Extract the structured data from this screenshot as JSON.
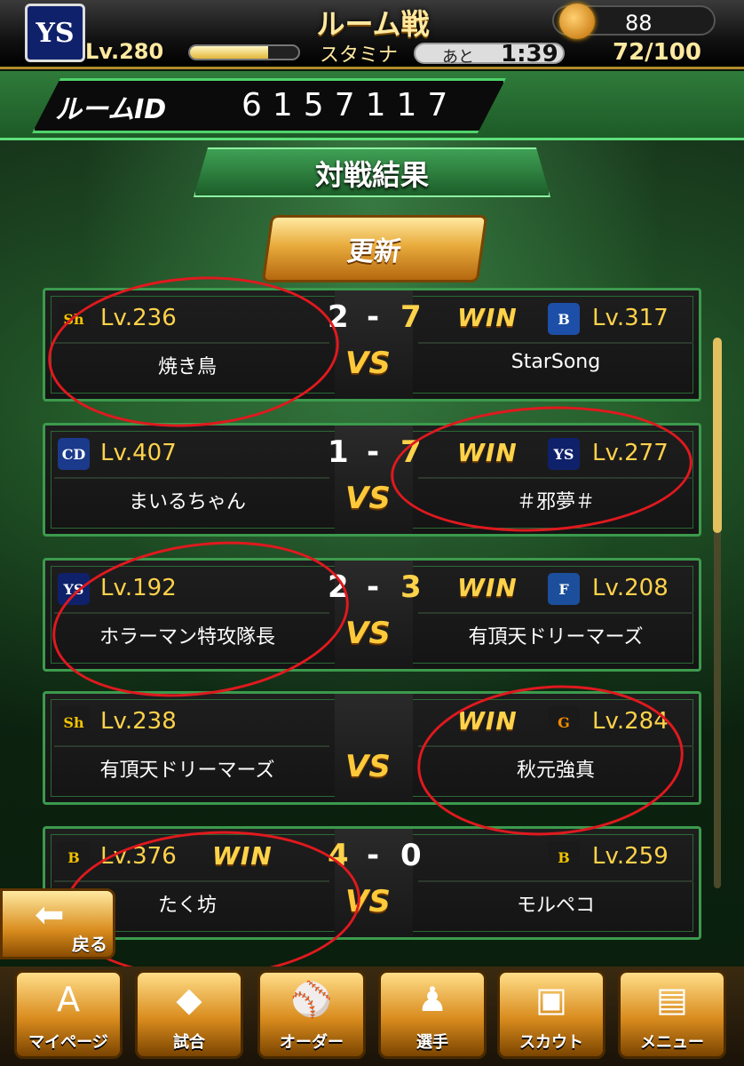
{
  "header": {
    "team_emblem": "YS",
    "title": "ルーム戦",
    "currency_value": "88",
    "level": "Lv.280",
    "stamina_label": "スタミナ",
    "stamina_fraction": 0.72,
    "remaining_label": "あと",
    "remaining_time": "1:39",
    "stamina_value": "72/100"
  },
  "room": {
    "label": "ルームID",
    "id": "6157117"
  },
  "section": {
    "title": "対戦結果"
  },
  "refresh_button": "更新",
  "vs_text": "VS",
  "win_text": "WIN",
  "dash": "-",
  "matches": [
    {
      "left": {
        "icon": "Sh",
        "level": "Lv.236",
        "name": "焼き鳥",
        "icon_color": "#1a1a1a",
        "icon_text_color": "#f2c300"
      },
      "right": {
        "icon": "B",
        "level": "Lv.317",
        "name": "StarSong",
        "icon_color": "#1d4fa8",
        "icon_text_color": "#ffffff"
      },
      "score_left": "2",
      "score_right": "7",
      "winner": "right"
    },
    {
      "left": {
        "icon": "CD",
        "level": "Lv.407",
        "name": "まいるちゃん",
        "icon_color": "#1b3a8c",
        "icon_text_color": "#ffffff"
      },
      "right": {
        "icon": "YS",
        "level": "Lv.277",
        "name": "＃邪夢＃",
        "icon_color": "#10216b",
        "icon_text_color": "#ffffff"
      },
      "score_left": "1",
      "score_right": "7",
      "winner": "right"
    },
    {
      "left": {
        "icon": "YS",
        "level": "Lv.192",
        "name": "ホラーマン特攻隊長",
        "icon_color": "#10216b",
        "icon_text_color": "#ffffff"
      },
      "right": {
        "icon": "F",
        "level": "Lv.208",
        "name": "有頂天ドリーマーズ",
        "icon_color": "#1b4f9c",
        "icon_text_color": "#ffffff"
      },
      "score_left": "2",
      "score_right": "3",
      "winner": "right"
    },
    {
      "left": {
        "icon": "Sh",
        "level": "Lv.238",
        "name": "有頂天ドリーマーズ",
        "icon_color": "#1a1a1a",
        "icon_text_color": "#f2c300"
      },
      "right": {
        "icon": "G",
        "level": "Lv.284",
        "name": "秋元強真",
        "icon_color": "#1a1a1a",
        "icon_text_color": "#f08a00"
      },
      "score_left": "",
      "score_right": "",
      "winner": "right"
    },
    {
      "left": {
        "icon": "B",
        "level": "Lv.376",
        "name": "たく坊",
        "icon_color": "#1a1a1a",
        "icon_text_color": "#f2c300"
      },
      "right": {
        "icon": "B",
        "level": "Lv.259",
        "name": "モルペコ",
        "icon_color": "#1a1a1a",
        "icon_text_color": "#f2c300"
      },
      "score_left": "4",
      "score_right": "0",
      "winner": "left"
    }
  ],
  "back_button": "戻る",
  "nav": [
    {
      "label": "マイページ",
      "icon": "A"
    },
    {
      "label": "試合",
      "icon": "◆"
    },
    {
      "label": "オーダー",
      "icon": "⚾"
    },
    {
      "label": "選手",
      "icon": "♟"
    },
    {
      "label": "スカウト",
      "icon": "▣"
    },
    {
      "label": "メニュー",
      "icon": "▤"
    }
  ],
  "colors": {
    "accent_green": "#3c9a4d",
    "gold": "#ffd24a",
    "annotation_red": "#e0191e"
  }
}
